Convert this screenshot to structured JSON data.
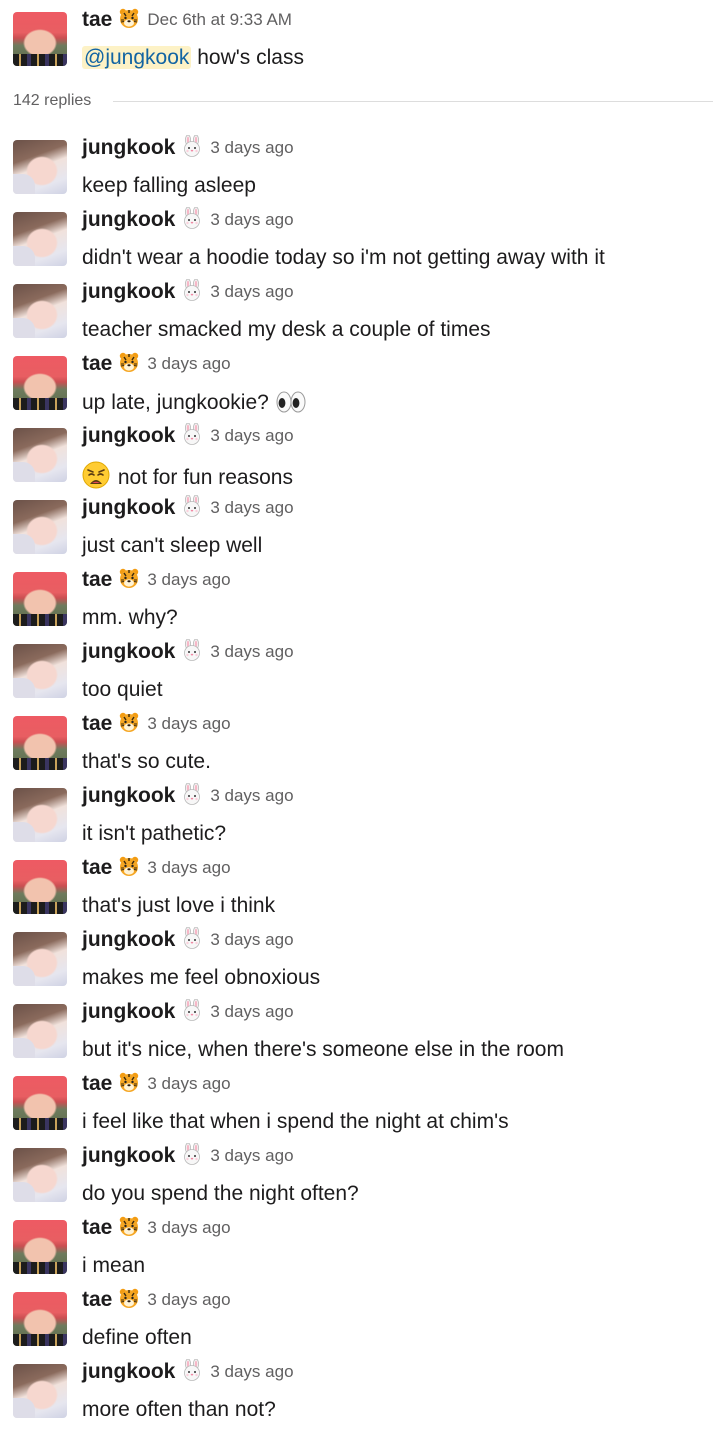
{
  "parent": {
    "author": "tae",
    "author_emoji": "tiger-icon",
    "timestamp": "Dec 6th at 9:33 AM",
    "mention": "@jungkook",
    "text": " how's class"
  },
  "replies_label": "142 replies",
  "messages": [
    {
      "author": "jungkook",
      "author_emoji": "rabbit-icon",
      "time": "3 days ago",
      "text": "keep falling asleep"
    },
    {
      "author": "jungkook",
      "author_emoji": "rabbit-icon",
      "time": "3 days ago",
      "text": "didn't wear a hoodie today so i'm not getting away with it"
    },
    {
      "author": "jungkook",
      "author_emoji": "rabbit-icon",
      "time": "3 days ago",
      "text": "teacher smacked my desk a couple of times"
    },
    {
      "author": "tae",
      "author_emoji": "tiger-icon",
      "time": "3 days ago",
      "text": "up late, jungkookie?",
      "trailing_emoji": "eyes-icon"
    },
    {
      "author": "jungkook",
      "author_emoji": "rabbit-icon",
      "time": "3 days ago",
      "leading_emoji": "weary-face-icon",
      "text": "not for fun reasons"
    },
    {
      "author": "jungkook",
      "author_emoji": "rabbit-icon",
      "time": "3 days ago",
      "text": "just can't sleep well"
    },
    {
      "author": "tae",
      "author_emoji": "tiger-icon",
      "time": "3 days ago",
      "text": "mm. why?"
    },
    {
      "author": "jungkook",
      "author_emoji": "rabbit-icon",
      "time": "3 days ago",
      "text": "too quiet"
    },
    {
      "author": "tae",
      "author_emoji": "tiger-icon",
      "time": "3 days ago",
      "text": "that's so cute."
    },
    {
      "author": "jungkook",
      "author_emoji": "rabbit-icon",
      "time": "3 days ago",
      "text": "it isn't pathetic?"
    },
    {
      "author": "tae",
      "author_emoji": "tiger-icon",
      "time": "3 days ago",
      "text": "that's just love i think"
    },
    {
      "author": "jungkook",
      "author_emoji": "rabbit-icon",
      "time": "3 days ago",
      "text": "makes me feel obnoxious"
    },
    {
      "author": "jungkook",
      "author_emoji": "rabbit-icon",
      "time": "3 days ago",
      "text": "but it's nice, when there's someone else in the room"
    },
    {
      "author": "tae",
      "author_emoji": "tiger-icon",
      "time": "3 days ago",
      "text": "i feel like that when i spend the night at chim's"
    },
    {
      "author": "jungkook",
      "author_emoji": "rabbit-icon",
      "time": "3 days ago",
      "text": "do you spend the night often?"
    },
    {
      "author": "tae",
      "author_emoji": "tiger-icon",
      "time": "3 days ago",
      "text": "i mean"
    },
    {
      "author": "tae",
      "author_emoji": "tiger-icon",
      "time": "3 days ago",
      "text": "define often"
    },
    {
      "author": "jungkook",
      "author_emoji": "rabbit-icon",
      "time": "3 days ago",
      "text": "more often than not?"
    }
  ]
}
